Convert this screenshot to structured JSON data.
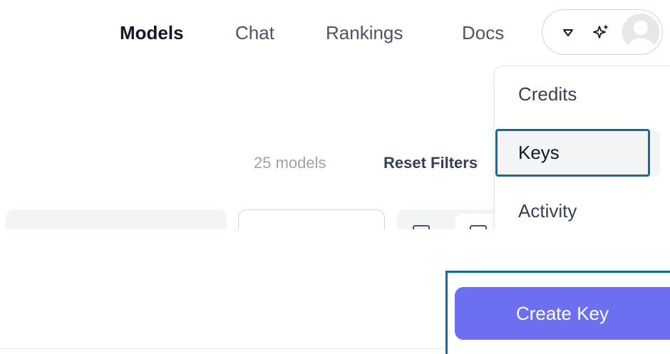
{
  "nav": {
    "links": [
      {
        "label": "Models",
        "active": true
      },
      {
        "label": "Chat"
      },
      {
        "label": "Rankings"
      },
      {
        "label": "Docs"
      }
    ]
  },
  "user_menu": {
    "icons": [
      "chevron-down-icon",
      "sparkle-icon",
      "avatar-icon"
    ],
    "items": [
      {
        "label": "Credits"
      },
      {
        "label": "Keys",
        "highlighted": true
      },
      {
        "label": "Activity"
      }
    ]
  },
  "filters": {
    "count_text": "25 models",
    "reset_label": "Reset Filters"
  },
  "actions": {
    "create_key_label": "Create Key"
  },
  "colors": {
    "accent": "#6c6ff0",
    "focus_outline": "#0e6f9c",
    "highlight_bg": "#f3f4f6"
  }
}
